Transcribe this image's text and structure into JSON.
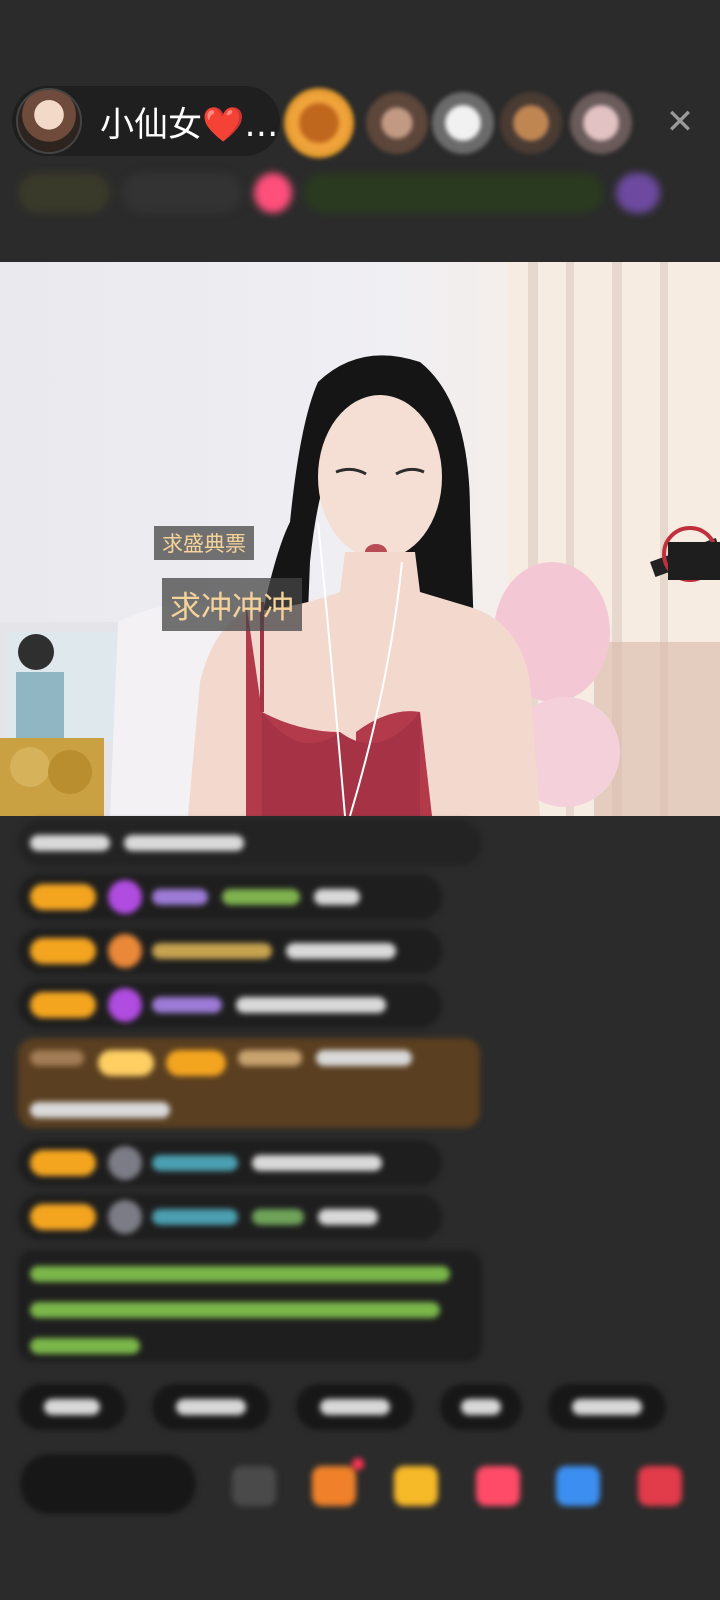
{
  "host": {
    "name": "小仙女❤️…",
    "avatar_icon": "host-avatar"
  },
  "viewers": [
    {
      "icon": "viewer-avatar-1",
      "color": "#d6892c"
    },
    {
      "icon": "viewer-avatar-2",
      "color": "#8a6a57"
    },
    {
      "icon": "viewer-avatar-3",
      "color": "#d9d9d9"
    },
    {
      "icon": "viewer-avatar-4",
      "color": "#b57d4f"
    },
    {
      "icon": "viewer-avatar-5",
      "color": "#d7b3b4"
    }
  ],
  "close_label": "✕",
  "video_overlays": {
    "line1": "求盛典票",
    "line2": "求冲冲冲"
  },
  "colors": {
    "background": "#2b2b2b",
    "badge": "#f4a51f",
    "overlay_text": "#f5d39a"
  }
}
